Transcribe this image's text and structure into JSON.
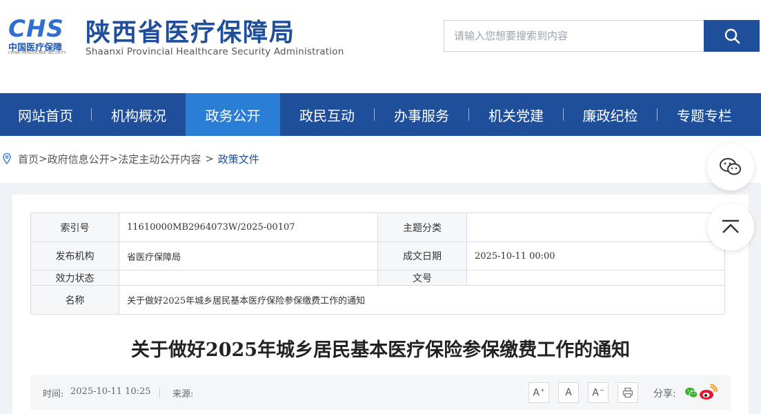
{
  "header": {
    "logo_text": "CHS",
    "logo_cn": "中国医疗保障",
    "logo_en": "CHINA HEALTHCARE SECURITY",
    "site_title": "陕西省医疗保障局",
    "site_subtitle": "Shaanxi Provincial Healthcare Security Administration",
    "search_placeholder": "请输入您想要搜索到内容",
    "search_icon": "search-icon"
  },
  "nav": {
    "items": [
      {
        "label": "网站首页"
      },
      {
        "label": "机构概况"
      },
      {
        "label": "政务公开",
        "active": true
      },
      {
        "label": "政民互动"
      },
      {
        "label": "办事服务"
      },
      {
        "label": "机关党建"
      },
      {
        "label": "廉政纪检"
      },
      {
        "label": "专题专栏"
      }
    ]
  },
  "breadcrumb": {
    "items": [
      "首页",
      "政府信息公开",
      "法定主动公开内容"
    ],
    "separator": ">",
    "current": "政策文件"
  },
  "info": {
    "index_label": "索引号",
    "index_value": "11610000MB2964073W/2025-00107",
    "topic_label": "主题分类",
    "topic_value": "",
    "publisher_label": "发布机构",
    "publisher_value": "省医疗保障局",
    "date_label": "成文日期",
    "date_value": "2025-10-11 00:00",
    "validity_label": "效力状态",
    "validity_value": "",
    "docno_label": "文号",
    "docno_value": "",
    "name_label": "名称",
    "name_value": "关于做好2025年城乡居民基本医疗保险参保缴费工作的通知"
  },
  "article": {
    "title": "关于做好2025年城乡居民基本医疗保险参保缴费工作的通知",
    "time_label": "时间:",
    "time_value": "2025-10-11 10:25",
    "source_label": "来源:",
    "source_value": "",
    "font_large": "A",
    "font_medium": "A",
    "font_small": "A",
    "share_label": "分享:"
  },
  "colors": {
    "brand": "#1f4e9a",
    "nav_active": "#2a7ed6",
    "wechat": "#3cb034",
    "weibo": "#e6162d"
  }
}
